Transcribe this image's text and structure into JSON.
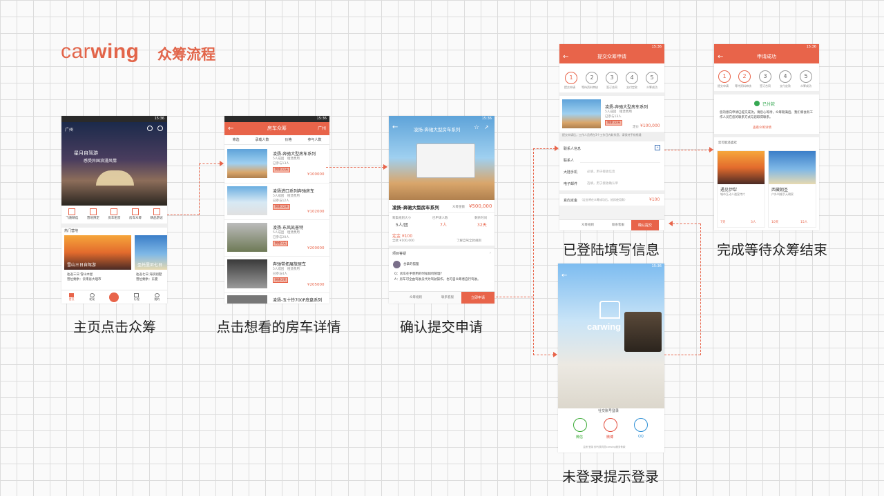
{
  "header": {
    "logo_prefix": "car",
    "logo_bold": "wing",
    "subtitle": "众筹流程"
  },
  "captions": {
    "s1": "主页点击众筹",
    "s2": "点击想看的房车详情",
    "s3": "确认提交申请",
    "s4": "已登陆填写信息",
    "s5": "完成等待众筹结束",
    "s6": "未登录提示登录"
  },
  "status_time": "15:36",
  "home": {
    "city": "广州",
    "banner_line1": "星月自驾游",
    "banner_line2": "感受异国浪漫风情",
    "cats": [
      "飞驰精选",
      "营地预定",
      "房车租赁",
      "房车众筹",
      "精品游记"
    ],
    "hot": "热门营地",
    "card1": "雪山三日自驾游",
    "card2": "圣托里尼七日",
    "card1_a": "往返三日 雪山木屋",
    "card1_b": "营位剩余：云南省大理市",
    "card2_a": "往返七日 海滨别墅",
    "card2_b": "营位剩余：东夏",
    "tabs": [
      "首页",
      "发现",
      "",
      "行程",
      "我的"
    ]
  },
  "list": {
    "title": "房车众筹",
    "city": "广州",
    "filters": [
      "筛选",
      "承载人数",
      "价格",
      "参与人数"
    ],
    "items": [
      {
        "name": "凌扬-奔驰大型房车系列",
        "a": "5人成团",
        "b": "租赁费用",
        "c": "已参与13人",
        "tag": "剩余32天",
        "price": "¥100000"
      },
      {
        "name": "凌扬进口系列奔驰房车",
        "a": "5人成团",
        "b": "租赁费用",
        "c": "已参与12人",
        "tag": "剩余32天",
        "price": "¥102000"
      },
      {
        "name": "凌扬-东风凯普特",
        "a": "5人成团",
        "b": "租赁费用",
        "c": "已参与20人",
        "tag": "剩余3天",
        "price": "¥200000"
      },
      {
        "name": "奔驰带拓展旅居车",
        "a": "5人成团",
        "b": "租赁费用",
        "c": "已参与4人",
        "tag": "剩余3天",
        "price": "¥205000"
      },
      {
        "name": "凌扬-五十铃700P底盘系列",
        "a": "",
        "b": "",
        "c": "",
        "tag": "",
        "price": ""
      }
    ]
  },
  "detail": {
    "title": "凌扬-奔驰大型房车系列",
    "name": "凌扬-奔驰大型房车系列",
    "label": "众筹金额",
    "amount": "¥500,000",
    "k1": "筹集规则大小",
    "v1": "5人/团",
    "k2": "已申请人数",
    "v2": "7人",
    "k3": "剩余时间",
    "v3": "32天",
    "d1": "定金 ¥100",
    "d2": "全款 ¥100,000",
    "link": "了解自驾全款规则",
    "sec": "项目答疑",
    "user": "合拿的猫狸",
    "q": "Q：房车在手使用的时候如何管理?",
    "a": "A：房车可全由驾驶员代为驾驶操作，也可自众筹者自行驾驶。",
    "b1": "众筹规则",
    "b2": "联系客服",
    "b3": "立即申请"
  },
  "form": {
    "title": "提交众筹申请",
    "steps": [
      "1",
      "2",
      "3",
      "4",
      "5"
    ],
    "step_labels": [
      "提交申请",
      "等待资料审核",
      "签订合同",
      "支付定款",
      "众筹成功"
    ],
    "car": "凌扬-奔驰大型房车系列",
    "a": "5人成团",
    "b": "租赁费用",
    "c": "已参与13人",
    "tag": "剩余32天",
    "price": "¥100,000",
    "price_lbl": "定价",
    "note": "提交申请后，工作人员将在3个工作日内联系您，请保持手机畅通",
    "f0": "联系人信息",
    "f1": "联系人",
    "f2": "大陆手机",
    "f2h": "必填，用于接收信息",
    "f3": "电子邮件",
    "f3h": "选填，用于接收确认单",
    "dep": "意向定金",
    "deph": "（定金将在众筹成功后，抵扣使用款）",
    "depv": "¥100",
    "b1": "众筹规则",
    "b2": "联系客服",
    "b3": "确认提交"
  },
  "done": {
    "title": "申请成功",
    "status": "已付款",
    "text": "您的意向申请已提交成功，请您心等待，众筹期满后，我们将会有工作人员在您的联系方式与您取得联系。",
    "link": "查看众筹详情",
    "sec": "您可能还喜欢",
    "c1": "遇见伊犁",
    "c1s": "城市互动人道宣传片",
    "c1t": "7天",
    "c1p": "3人",
    "c2": "西藏朝圣",
    "c2s": "户外叫顺手天朝家",
    "c2t": "10天",
    "c2p": "15人"
  },
  "login": {
    "brand": "carwing",
    "social": "社交账号登录",
    "opts": [
      "微信",
      "微博",
      "QQ"
    ],
    "foot": "注册 登录 即代表同意carwing服务条款"
  }
}
